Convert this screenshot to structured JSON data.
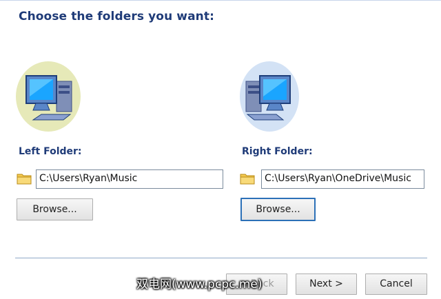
{
  "header": {
    "title": "Choose the folders you want:"
  },
  "left": {
    "label": "Left Folder:",
    "path": "C:\\Users\\Ryan\\Music",
    "browse_label": "Browse..."
  },
  "right": {
    "label": "Right Folder:",
    "path": "C:\\Users\\Ryan\\OneDrive\\Music",
    "browse_label": "Browse..."
  },
  "footer": {
    "back_label": "< Back",
    "next_label": "Next >",
    "cancel_label": "Cancel"
  },
  "watermark": "双电网(www.pcpc.me)",
  "colors": {
    "heading": "#1f3b78",
    "left_icon_bg": "#e6e9b8",
    "right_icon_bg": "#d3e2f5",
    "focus_border": "#2b70b7"
  },
  "icons": {
    "left_computer": "computer-icon",
    "right_computer": "computer-icon",
    "folder": "folder-icon"
  }
}
